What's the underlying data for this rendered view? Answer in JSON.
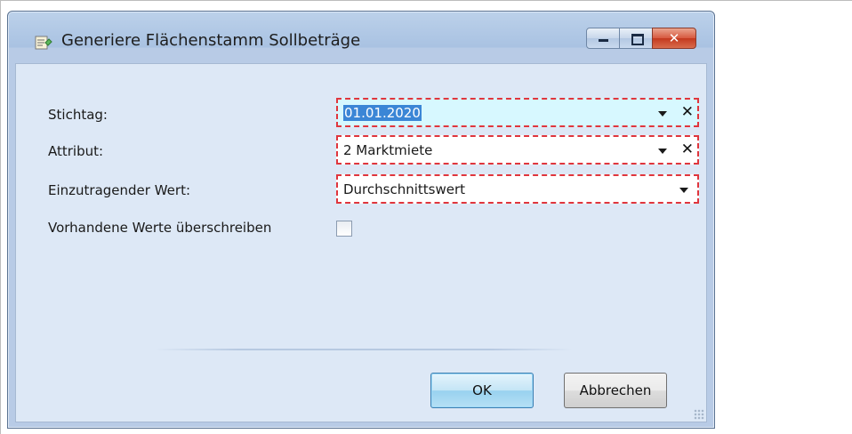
{
  "dialog": {
    "title": "Generiere Flächenstamm Sollbeträge",
    "window_buttons": {
      "minimize": "minimize",
      "maximize": "maximize",
      "close": "close"
    }
  },
  "form": {
    "stichtag": {
      "label": "Stichtag:",
      "value": "01.01.2020"
    },
    "attribut": {
      "label": "Attribut:",
      "value": "2 Marktmiete"
    },
    "einzutragender_wert": {
      "label": "Einzutragender Wert:",
      "value": "Durchschnittswert"
    },
    "ueberschreiben": {
      "label": "Vorhandene Werte überschreiben",
      "checked": false
    }
  },
  "buttons": {
    "ok": "OK",
    "cancel": "Abbrechen"
  },
  "colors": {
    "required_border": "#e0363d",
    "selection": "#3b86d6",
    "client_bg": "#dde8f6"
  }
}
